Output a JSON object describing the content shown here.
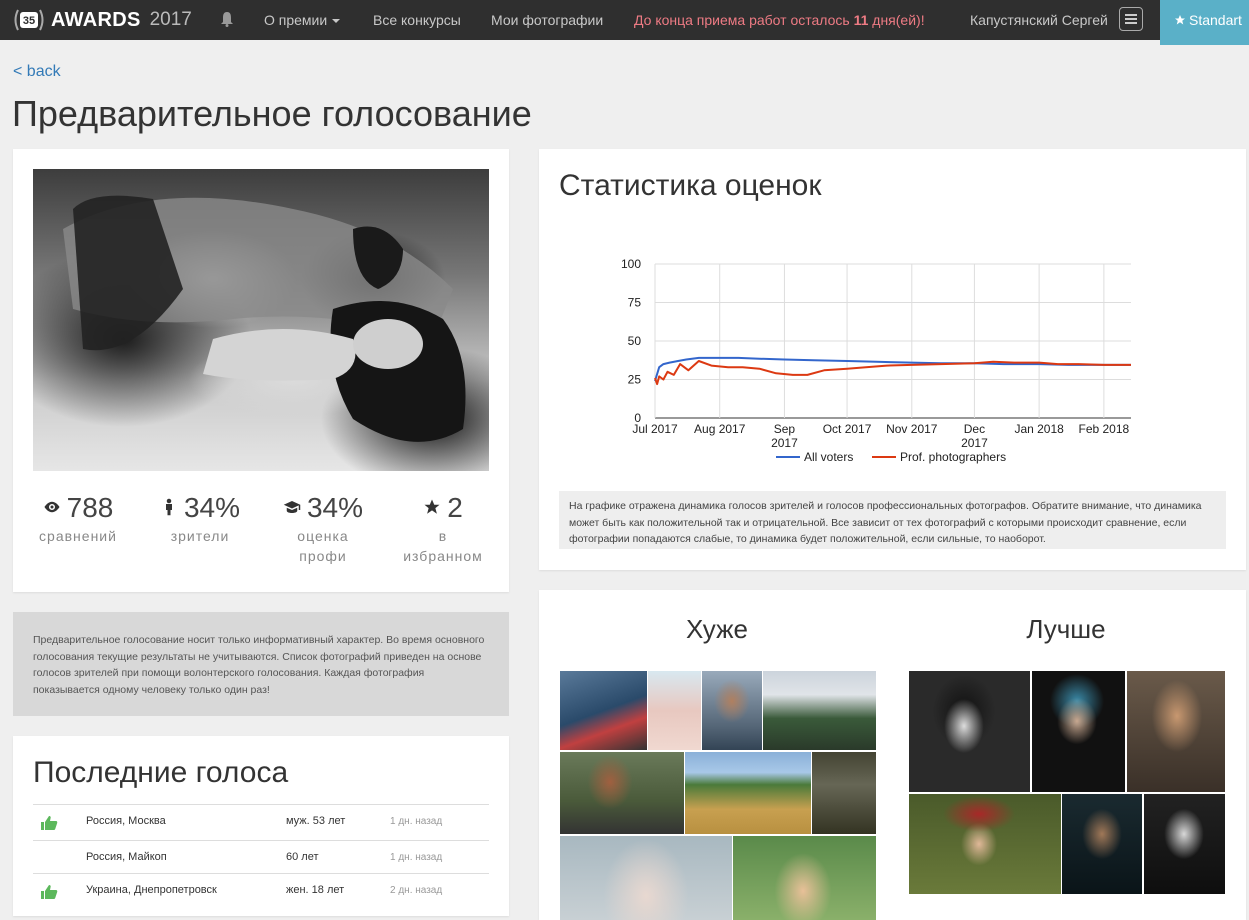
{
  "nav": {
    "brand": "AWARDS",
    "year": "2017",
    "about_label": "О премии",
    "all_contests_label": "Все конкурсы",
    "my_photos_label": "Мои фотографии",
    "deadline_prefix": "До конца приема работ осталось",
    "deadline_days": "11",
    "deadline_suffix": "дня(ей)!",
    "user_name": "Капустянский Сергей",
    "standart_label": "Standart"
  },
  "back_label": "< back",
  "page_title": "Предварительное голосование",
  "stats": [
    {
      "icon": "eye-icon",
      "value": "788",
      "label": "сравнений"
    },
    {
      "icon": "person-icon",
      "value": "34%",
      "label": "зрители"
    },
    {
      "icon": "graduation-cap-icon",
      "value": "34%",
      "label": "оценка профи"
    },
    {
      "icon": "star-icon",
      "value": "2",
      "label": "в избранном"
    }
  ],
  "info_note": "Предварительное голосование носит только информативный характер. Во время основного голосования текущие результаты не учитываются. Список фотографий приведен на основе голосов зрителей при помощи волонтерского голосования. Каждая фотография показывается одному человеку только один раз!",
  "recent_votes": {
    "title": "Последние голоса",
    "rows": [
      {
        "liked": true,
        "location": "Россия, Москва",
        "age": "муж. 53 лет",
        "time": "1 дн. назад"
      },
      {
        "liked": false,
        "location": "Россия, Майкоп",
        "age": "60 лет",
        "time": "1 дн. назад"
      },
      {
        "liked": true,
        "location": "Украина, Днепропетровск",
        "age": "жен. 18 лет",
        "time": "2 дн. назад"
      }
    ]
  },
  "statistics": {
    "title": "Статистика оценок",
    "note": "На графике отражена динамика голосов зрителей и голосов профессиональных фотографов. Обратите внимание, что динамика может быть как положительной так и отрицательной. Все зависит от тех фотографий с которыми происходит сравнение, если фотографии попадаются слабые, то динамика будет положительной, если сильные, то наоборот."
  },
  "chart_data": {
    "type": "line",
    "title": "",
    "xlabel": "",
    "ylabel": "",
    "ylim": [
      0,
      100
    ],
    "yticks": [
      0,
      25,
      50,
      75,
      100
    ],
    "x_tick_labels": [
      "Jul 2017",
      "Aug 2017",
      "Sep 2017",
      "Oct 2017",
      "Nov 2017",
      "Dec 2017",
      "Jan 2018",
      "Feb 2018"
    ],
    "x_tick_dates": [
      "2017-07-01",
      "2017-08-01",
      "2017-09-01",
      "2017-10-01",
      "2017-11-01",
      "2017-12-01",
      "2018-01-01",
      "2018-02-01"
    ],
    "xlim": [
      "2017-07-01",
      "2018-02-14"
    ],
    "grid": true,
    "legend": "bottom",
    "series": [
      {
        "name": "All voters",
        "color": "#3366cc",
        "x": [
          "2017-07-01",
          "2017-07-03",
          "2017-07-05",
          "2017-07-08",
          "2017-07-12",
          "2017-07-16",
          "2017-07-22",
          "2017-08-01",
          "2017-08-10",
          "2017-08-20",
          "2017-09-01",
          "2017-09-15",
          "2017-10-01",
          "2017-10-15",
          "2017-11-01",
          "2017-11-15",
          "2017-12-01",
          "2017-12-15",
          "2018-01-01",
          "2018-01-15",
          "2018-02-01",
          "2018-02-14"
        ],
        "y": [
          24,
          33,
          35,
          36,
          37,
          38,
          39,
          39,
          39,
          38.5,
          38,
          37.5,
          37,
          36.5,
          36,
          35.5,
          35.5,
          35,
          35,
          34.5,
          34.5,
          34.5
        ]
      },
      {
        "name": "Prof. photographers",
        "color": "#dc3912",
        "x": [
          "2017-07-01",
          "2017-07-02",
          "2017-07-03",
          "2017-07-05",
          "2017-07-07",
          "2017-07-10",
          "2017-07-13",
          "2017-07-17",
          "2017-07-22",
          "2017-07-28",
          "2017-08-05",
          "2017-08-12",
          "2017-08-20",
          "2017-08-28",
          "2017-09-05",
          "2017-09-12",
          "2017-09-20",
          "2017-10-01",
          "2017-10-10",
          "2017-10-20",
          "2017-11-01",
          "2017-11-15",
          "2017-12-01",
          "2017-12-10",
          "2017-12-20",
          "2018-01-01",
          "2018-01-10",
          "2018-01-20",
          "2018-02-01",
          "2018-02-14"
        ],
        "y": [
          26,
          22,
          27,
          25,
          30,
          28,
          35,
          31,
          37,
          34,
          33,
          33,
          32,
          29,
          28,
          28,
          31,
          32,
          33,
          34,
          34.5,
          35,
          35.5,
          36.5,
          36,
          36,
          35,
          35,
          34.5,
          34.5
        ]
      }
    ]
  },
  "compare": {
    "worse_label": "Хуже",
    "better_label": "Лучше"
  }
}
